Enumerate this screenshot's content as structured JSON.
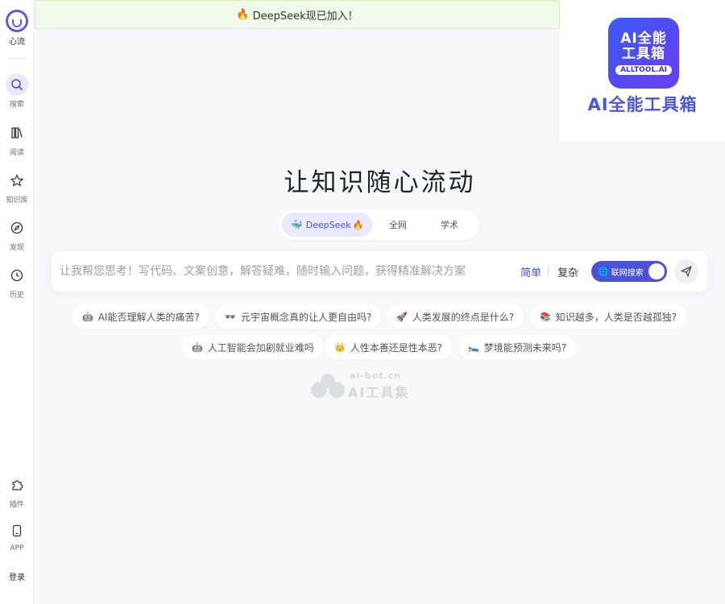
{
  "sidebar": {
    "logo_label": "心流",
    "items": [
      {
        "label": "搜索",
        "icon": "search-icon",
        "active": true
      },
      {
        "label": "阅读",
        "icon": "book-icon",
        "active": false
      },
      {
        "label": "知识库",
        "icon": "knowledge-base-icon",
        "active": false
      },
      {
        "label": "发现",
        "icon": "compass-icon",
        "active": false
      },
      {
        "label": "历史",
        "icon": "clock-icon",
        "active": false
      }
    ],
    "bottom_items": [
      {
        "label": "插件",
        "icon": "puzzle-icon"
      },
      {
        "label": "APP",
        "icon": "phone-icon"
      }
    ],
    "login_label": "登录"
  },
  "banner": {
    "text": "DeepSeek现已加入！",
    "icon": "fire-icon"
  },
  "ad": {
    "logo_line1": "AI全能",
    "logo_line2": "工具箱",
    "logo_badge": "ALLTOOL.AI",
    "title": "AI全能工具箱"
  },
  "main": {
    "headline": "让知识随心流动",
    "tabs": [
      {
        "label": "DeepSeek",
        "active": true
      },
      {
        "label": "全网",
        "active": false
      },
      {
        "label": "学术",
        "active": false
      }
    ],
    "search": {
      "placeholder": "让我帮您思考！写代码、文案创意，解答疑难，随时输入问题，获得精准解决方案",
      "value": "",
      "mode_simple": "简单",
      "mode_complex": "复杂",
      "web_search_label": "联网搜索",
      "web_search_on": true
    },
    "suggestions": [
      {
        "emoji": "🤖",
        "text": "AI能否理解人类的痛苦?"
      },
      {
        "emoji": "🕶",
        "text": "元宇宙概念真的让人更自由吗?"
      },
      {
        "emoji": "🚀",
        "text": "人类发展的终点是什么?"
      },
      {
        "emoji": "📚",
        "text": "知识越多，人类是否越孤独?"
      },
      {
        "emoji": "🤖",
        "text": "人工智能会加剧就业难吗"
      },
      {
        "emoji": "👑",
        "text": "人性本善还是性本恶?"
      },
      {
        "emoji": "🛌",
        "text": "梦境能预测未来吗?"
      }
    ]
  },
  "watermark": {
    "url": "ai-bot.cn",
    "name": "AI工具集"
  },
  "colors": {
    "accent": "#4a52d8",
    "banner_bg": "#f0fbe9",
    "page_bg": "#f7f8fa"
  }
}
